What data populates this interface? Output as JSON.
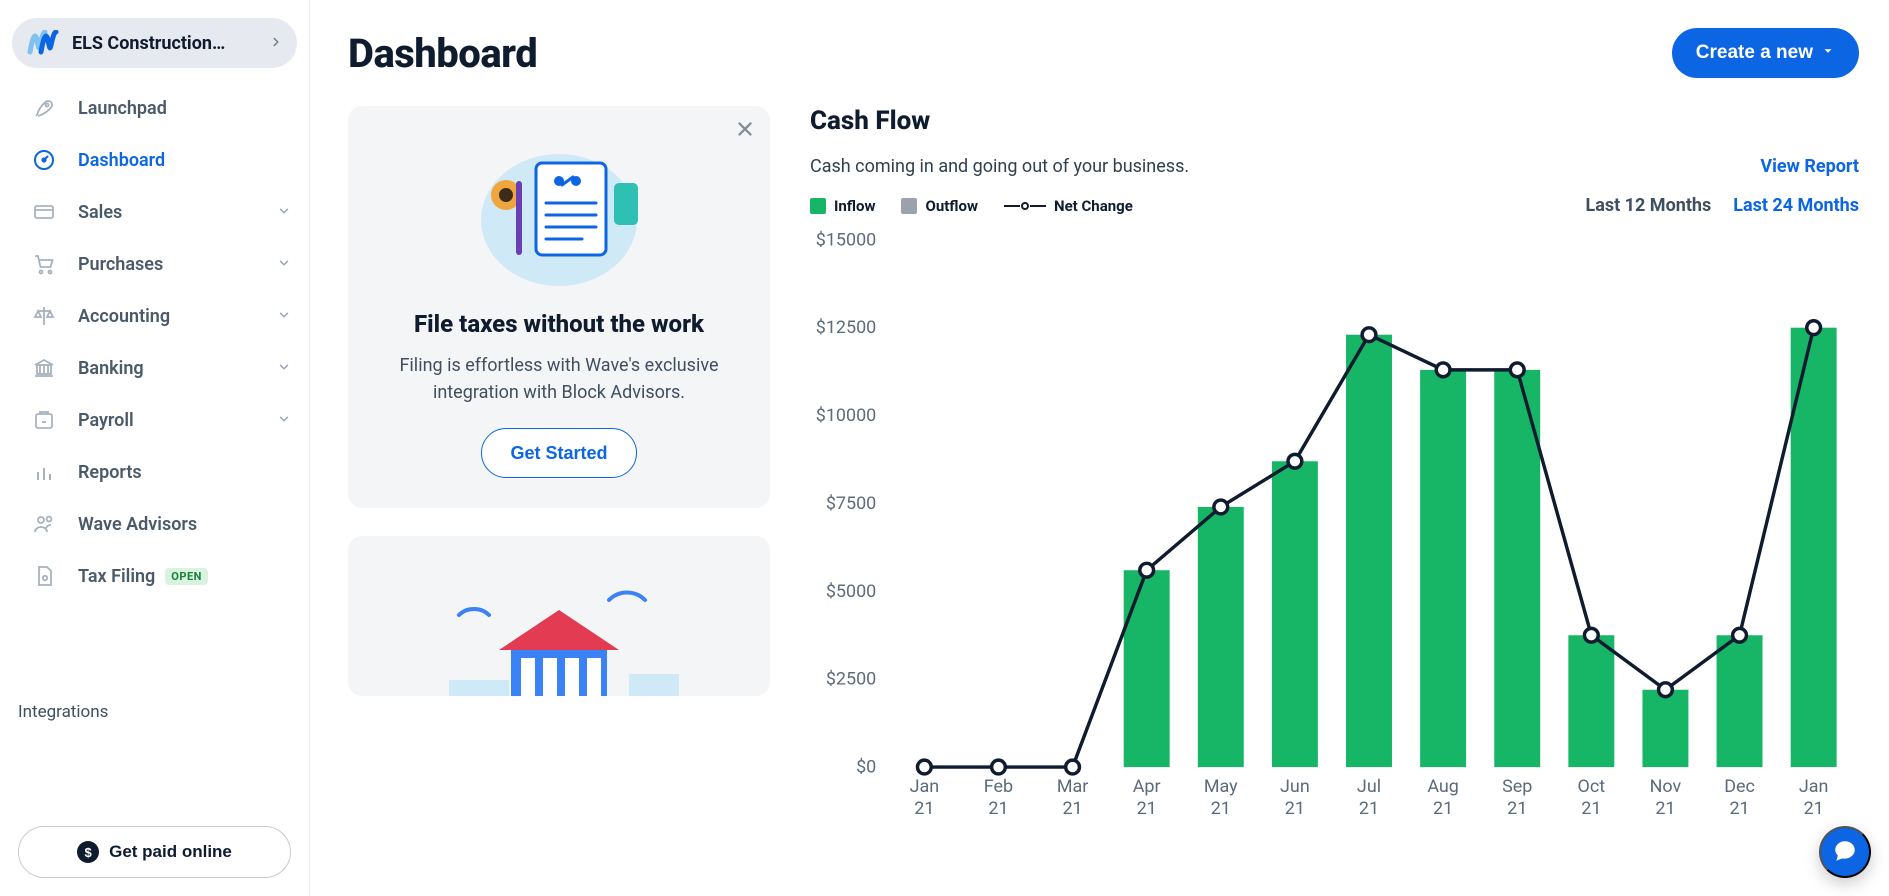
{
  "colors": {
    "primary": "#0c66e4",
    "inflow": "#17b667",
    "outflow": "#9aa3ad",
    "text": "#0f1b2e"
  },
  "org": {
    "name": "ELS Construction…"
  },
  "sidebar": {
    "items": [
      {
        "label": "Launchpad",
        "icon": "rocket-icon",
        "expandable": false
      },
      {
        "label": "Dashboard",
        "icon": "dashboard-icon",
        "expandable": false,
        "active": true
      },
      {
        "label": "Sales",
        "icon": "card-icon",
        "expandable": true
      },
      {
        "label": "Purchases",
        "icon": "cart-icon",
        "expandable": true
      },
      {
        "label": "Accounting",
        "icon": "balance-icon",
        "expandable": true
      },
      {
        "label": "Banking",
        "icon": "bank-icon",
        "expandable": true
      },
      {
        "label": "Payroll",
        "icon": "payroll-icon",
        "expandable": true
      },
      {
        "label": "Reports",
        "icon": "reports-icon",
        "expandable": false
      },
      {
        "label": "Wave Advisors",
        "icon": "advisors-icon",
        "expandable": false
      },
      {
        "label": "Tax Filing",
        "icon": "taxfile-icon",
        "expandable": false,
        "badge": "OPEN"
      }
    ],
    "integrations_label": "Integrations",
    "footer_button": "Get paid online"
  },
  "header": {
    "title": "Dashboard",
    "create_btn": "Create a new"
  },
  "promo": {
    "title": "File taxes without the work",
    "desc": "Filing is effortless with Wave's exclusive integration with Block Advisors.",
    "cta": "Get Started"
  },
  "cashflow": {
    "title": "Cash Flow",
    "desc": "Cash coming in and going out of your business.",
    "view_report": "View Report",
    "legend": {
      "inflow": "Inflow",
      "outflow": "Outflow",
      "net": "Net Change"
    },
    "timeframes": {
      "tf12": "Last 12 Months",
      "tf24": "Last 24 Months",
      "active": "tf24"
    }
  },
  "chart_data": {
    "type": "bar",
    "title": "Cash Flow",
    "xlabel": "",
    "ylabel": "",
    "ylim": [
      0,
      15000
    ],
    "yticks": [
      0,
      2500,
      5000,
      7500,
      10000,
      12500,
      15000
    ],
    "ytick_labels": [
      "$0",
      "$2500",
      "$5000",
      "$7500",
      "$10000",
      "$12500",
      "$15000"
    ],
    "categories": [
      {
        "l1": "Jan",
        "l2": "21"
      },
      {
        "l1": "Feb",
        "l2": "21"
      },
      {
        "l1": "Mar",
        "l2": "21"
      },
      {
        "l1": "Apr",
        "l2": "21"
      },
      {
        "l1": "May",
        "l2": "21"
      },
      {
        "l1": "Jun",
        "l2": "21"
      },
      {
        "l1": "Jul",
        "l2": "21"
      },
      {
        "l1": "Aug",
        "l2": "21"
      },
      {
        "l1": "Sep",
        "l2": "21"
      },
      {
        "l1": "Oct",
        "l2": "21"
      },
      {
        "l1": "Nov",
        "l2": "21"
      },
      {
        "l1": "Dec",
        "l2": "21"
      },
      {
        "l1": "Jan",
        "l2": "21"
      }
    ],
    "series": [
      {
        "name": "Inflow",
        "values": [
          0,
          0,
          0,
          5600,
          7400,
          8700,
          12300,
          11300,
          11300,
          3750,
          2200,
          3750,
          12500
        ]
      },
      {
        "name": "Net Change",
        "values": [
          0,
          0,
          0,
          5600,
          7400,
          8700,
          12300,
          11300,
          11300,
          3750,
          2200,
          3750,
          12500
        ]
      }
    ]
  }
}
